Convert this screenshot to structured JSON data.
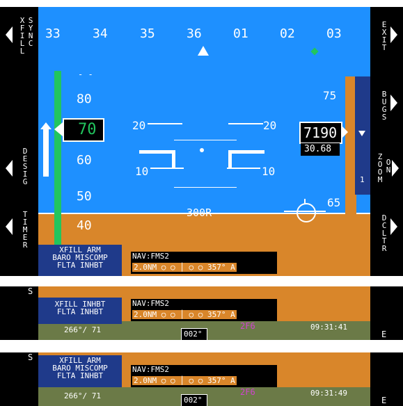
{
  "heading_tape": {
    "labels": [
      "33",
      "34",
      "35",
      "36",
      "01",
      "02",
      "03"
    ]
  },
  "left_softkeys": [
    {
      "label": "X\nF\nI\nL\nL"
    },
    {
      "label": "S\nY\nN\nC"
    },
    {
      "label": "D\nE\nS\nI\nG"
    },
    {
      "label": "T\nI\nM\nE\nR"
    }
  ],
  "right_softkeys": [
    {
      "label": "E\nX\nI\nT"
    },
    {
      "label": "B\nU\nG\nS"
    },
    {
      "label": "Z\nO\nO\nM"
    },
    {
      "label": "O\nN"
    },
    {
      "label": "D\nC\nL\nT\nR"
    }
  ],
  "airspeed": {
    "current": "70",
    "ticks": [
      "80",
      "60",
      "50",
      "40"
    ]
  },
  "altitude": {
    "current": "7190",
    "baro": "30.68",
    "ticks": [
      "75",
      "65"
    ],
    "bug_label": "1"
  },
  "pitch_ladder": {
    "labels_left": [
      "20",
      "10"
    ],
    "labels_right": [
      "20",
      "10"
    ]
  },
  "range_label": "300R",
  "messages": {
    "panel1": [
      "XFILL ARM",
      "BARO MISCOMP",
      "FLTA INHBT"
    ],
    "panel2": [
      "XFILL INHBT",
      "FLTA INHBT"
    ],
    "panel3": [
      "XFILL ARM",
      "BARO MISCOMP",
      "FLTA INHBT"
    ]
  },
  "nav": {
    "source": "NAV:FMS2",
    "distance": "2.0NM",
    "bearing": "357° A"
  },
  "map": {
    "wind": "266°/ 71",
    "heading_box": "002°",
    "waypoint": "2F6",
    "time1": "09:31:41",
    "time2": "09:31:49",
    "dcltr": "DCLTR",
    "letter_e": "E",
    "letter_s": "S"
  },
  "colors": {
    "sky": "#1e90ff",
    "ground": "#d9862a",
    "message_bg": "#1f3a8a",
    "green": "#22c55e",
    "magenta": "#d042d0"
  }
}
